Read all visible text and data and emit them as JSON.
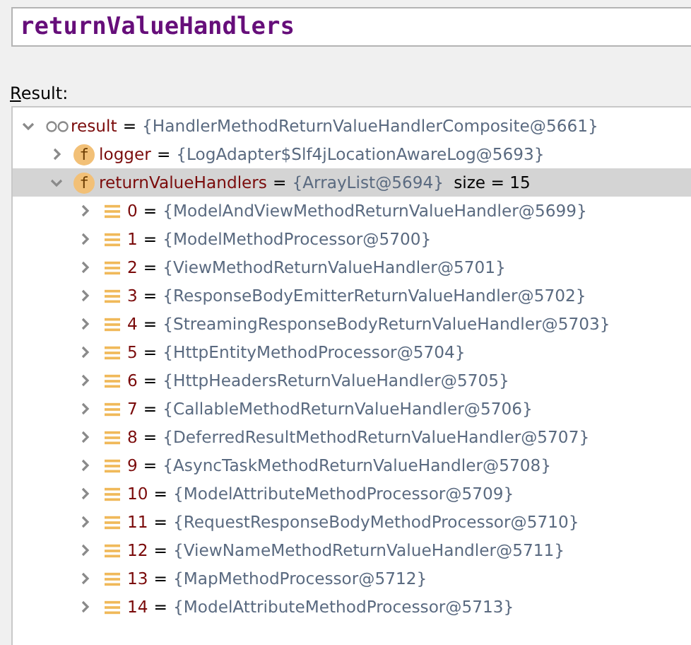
{
  "expression": {
    "value": "returnValueHandlers"
  },
  "result_label": "Result:",
  "tree": [
    {
      "kind": "watch",
      "name": "result",
      "equals": "=",
      "value": "{HandlerMethodReturnValueHandlerComposite@5661}",
      "expanded": true,
      "selected": false,
      "children": [
        {
          "kind": "field",
          "icon_text": "f",
          "name": "logger",
          "equals": "=",
          "value": "{LogAdapter$Slf4jLocationAwareLog@5693}",
          "expanded": false,
          "selected": false
        },
        {
          "kind": "field",
          "icon_text": "f",
          "name": "returnValueHandlers",
          "equals": "=",
          "value": "{ArrayList@5694}",
          "extra": "size = 15",
          "expanded": true,
          "selected": true,
          "children": [
            {
              "kind": "element",
              "name": "0",
              "equals": "=",
              "value": "{ModelAndViewMethodReturnValueHandler@5699}",
              "expanded": false,
              "selected": false
            },
            {
              "kind": "element",
              "name": "1",
              "equals": "=",
              "value": "{ModelMethodProcessor@5700}",
              "expanded": false,
              "selected": false
            },
            {
              "kind": "element",
              "name": "2",
              "equals": "=",
              "value": "{ViewMethodReturnValueHandler@5701}",
              "expanded": false,
              "selected": false
            },
            {
              "kind": "element",
              "name": "3",
              "equals": "=",
              "value": "{ResponseBodyEmitterReturnValueHandler@5702}",
              "expanded": false,
              "selected": false
            },
            {
              "kind": "element",
              "name": "4",
              "equals": "=",
              "value": "{StreamingResponseBodyReturnValueHandler@5703}",
              "expanded": false,
              "selected": false
            },
            {
              "kind": "element",
              "name": "5",
              "equals": "=",
              "value": "{HttpEntityMethodProcessor@5704}",
              "expanded": false,
              "selected": false
            },
            {
              "kind": "element",
              "name": "6",
              "equals": "=",
              "value": "{HttpHeadersReturnValueHandler@5705}",
              "expanded": false,
              "selected": false
            },
            {
              "kind": "element",
              "name": "7",
              "equals": "=",
              "value": "{CallableMethodReturnValueHandler@5706}",
              "expanded": false,
              "selected": false
            },
            {
              "kind": "element",
              "name": "8",
              "equals": "=",
              "value": "{DeferredResultMethodReturnValueHandler@5707}",
              "expanded": false,
              "selected": false
            },
            {
              "kind": "element",
              "name": "9",
              "equals": "=",
              "value": "{AsyncTaskMethodReturnValueHandler@5708}",
              "expanded": false,
              "selected": false
            },
            {
              "kind": "element",
              "name": "10",
              "equals": "=",
              "value": "{ModelAttributeMethodProcessor@5709}",
              "expanded": false,
              "selected": false
            },
            {
              "kind": "element",
              "name": "11",
              "equals": "=",
              "value": "{RequestResponseBodyMethodProcessor@5710}",
              "expanded": false,
              "selected": false
            },
            {
              "kind": "element",
              "name": "12",
              "equals": "=",
              "value": "{ViewNameMethodReturnValueHandler@5711}",
              "expanded": false,
              "selected": false
            },
            {
              "kind": "element",
              "name": "13",
              "equals": "=",
              "value": "{MapMethodProcessor@5712}",
              "expanded": false,
              "selected": false
            },
            {
              "kind": "element",
              "name": "14",
              "equals": "=",
              "value": "{ModelAttributeMethodProcessor@5713}",
              "expanded": false,
              "selected": false
            }
          ]
        }
      ]
    }
  ]
}
